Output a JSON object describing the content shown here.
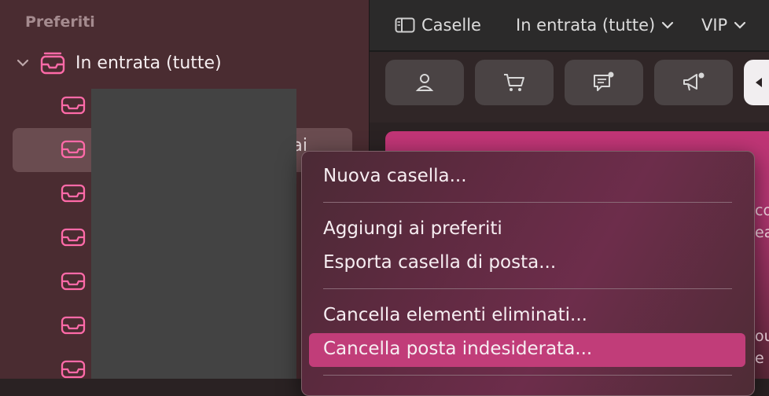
{
  "sidebar": {
    "section_title": "Preferiti",
    "inbox_all_label": "In entrata (tutte)",
    "partial_label": "mai"
  },
  "toolbar": {
    "mailboxes_label": "Caselle",
    "inbox_filter_label": "In entrata (tutte)",
    "vip_label": "VIP"
  },
  "promo": {
    "frag1": "co",
    "frag2": "ea",
    "frag3": "ou",
    "frag4": "e"
  },
  "context_menu": {
    "new_mailbox": "Nuova casella...",
    "add_to_favorites": "Aggiungi ai preferiti",
    "export_mailbox": "Esporta casella di posta...",
    "erase_deleted": "Cancella elementi eliminati...",
    "erase_junk": "Cancella posta indesiderata..."
  },
  "colors": {
    "accent": "#c13d79",
    "mailbox_icon": "#ff6aa8"
  }
}
